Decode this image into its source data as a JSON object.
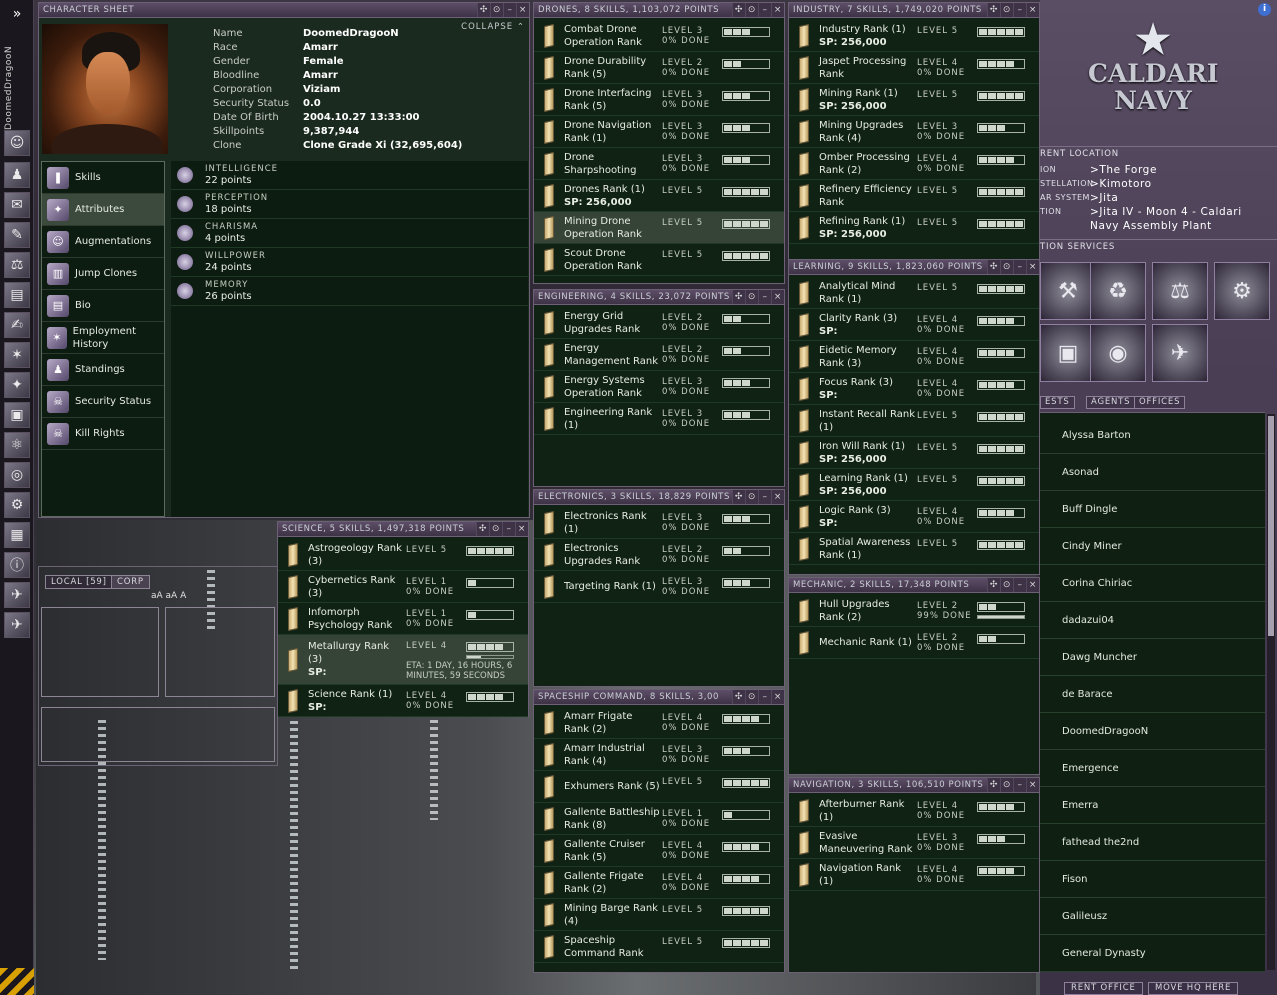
{
  "sidebar": {
    "expand": "»",
    "pilot": "DoomedDragooN"
  },
  "char": {
    "title": "CHARACTER SHEET",
    "collapse": "COLLAPSE",
    "fields": [
      {
        "k": "Name",
        "v": "DoomedDragooN"
      },
      {
        "k": "Race",
        "v": "Amarr"
      },
      {
        "k": "Gender",
        "v": "Female"
      },
      {
        "k": "Bloodline",
        "v": "Amarr"
      },
      {
        "k": "Corporation",
        "v": "Viziam"
      },
      {
        "k": "Security Status",
        "v": "0.0"
      },
      {
        "k": "Date Of Birth",
        "v": "2004.10.27 13:33:00"
      },
      {
        "k": "Skillpoints",
        "v": "9,387,944"
      },
      {
        "k": "Clone",
        "v": "Clone Grade Xi (32,695,604)"
      }
    ],
    "nav": [
      "Skills",
      "Attributes",
      "Augmentations",
      "Jump Clones",
      "Bio",
      "Employment History",
      "Standings",
      "Security Status",
      "Kill Rights"
    ],
    "attrs": [
      {
        "n": "INTELLIGENCE",
        "v": "22 points"
      },
      {
        "n": "PERCEPTION",
        "v": "18 points"
      },
      {
        "n": "CHARISMA",
        "v": "4 points"
      },
      {
        "n": "WILLPOWER",
        "v": "24 points"
      },
      {
        "n": "MEMORY",
        "v": "26 points"
      }
    ]
  },
  "panels": {
    "drones": {
      "title": "DRONES, 8 SKILLS, 1,103,072 POINTS",
      "skills": [
        {
          "n": "Combat Drone Operation Rank",
          "lvl": "LEVEL 3",
          "done": "0% DONE",
          "bars": 3
        },
        {
          "n": "Drone Durability Rank (5)",
          "lvl": "LEVEL 2",
          "done": "0% DONE",
          "bars": 2
        },
        {
          "n": "Drone Interfacing Rank (5)",
          "lvl": "LEVEL 3",
          "done": "0% DONE",
          "bars": 3
        },
        {
          "n": "Drone Navigation Rank (1)",
          "lvl": "LEVEL 3",
          "done": "0% DONE",
          "bars": 3
        },
        {
          "n": "Drone Sharpshooting",
          "lvl": "LEVEL 3",
          "done": "0% DONE",
          "bars": 3
        },
        {
          "n": "Drones Rank (1)",
          "sp": "SP: 256,000",
          "lvl": "LEVEL 5",
          "bars": 5
        },
        {
          "n": "Mining Drone Operation Rank",
          "lvl": "LEVEL 5",
          "bars": 5,
          "hl": true
        },
        {
          "n": "Scout Drone Operation Rank",
          "lvl": "LEVEL 5",
          "bars": 5
        }
      ]
    },
    "industry": {
      "title": "INDUSTRY, 7 SKILLS, 1,749,020 POINTS",
      "skills": [
        {
          "n": "Industry Rank (1)",
          "sp": "SP: 256,000",
          "lvl": "LEVEL 5",
          "bars": 5
        },
        {
          "n": "Jaspet Processing Rank",
          "lvl": "LEVEL 4",
          "done": "0% DONE",
          "bars": 4
        },
        {
          "n": "Mining Rank (1)",
          "sp": "SP: 256,000",
          "lvl": "LEVEL 5",
          "bars": 5
        },
        {
          "n": "Mining Upgrades Rank (4)",
          "lvl": "LEVEL 3",
          "done": "0% DONE",
          "bars": 3
        },
        {
          "n": "Omber Processing Rank (2)",
          "lvl": "LEVEL 4",
          "done": "0% DONE",
          "bars": 4
        },
        {
          "n": "Refinery Efficiency Rank",
          "lvl": "LEVEL 5",
          "bars": 5
        },
        {
          "n": "Refining Rank (1)",
          "sp": "SP: 256,000",
          "lvl": "LEVEL 5",
          "bars": 5
        }
      ]
    },
    "engineering": {
      "title": "ENGINEERING, 4 SKILLS, 23,072 POINTS",
      "skills": [
        {
          "n": "Energy Grid Upgrades Rank",
          "lvl": "LEVEL 2",
          "done": "0% DONE",
          "bars": 2
        },
        {
          "n": "Energy Management Rank",
          "lvl": "LEVEL 2",
          "done": "0% DONE",
          "bars": 2
        },
        {
          "n": "Energy Systems Operation Rank",
          "lvl": "LEVEL 3",
          "done": "0% DONE",
          "bars": 3
        },
        {
          "n": "Engineering Rank (1)",
          "lvl": "LEVEL 3",
          "done": "0% DONE",
          "bars": 3
        }
      ]
    },
    "learning": {
      "title": "LEARNING, 9 SKILLS, 1,823,060 POINTS",
      "skills": [
        {
          "n": "Analytical Mind Rank (1)",
          "lvl": "LEVEL 5",
          "bars": 5
        },
        {
          "n": "Clarity Rank (3)",
          "sp": "SP:",
          "lvl": "LEVEL 4",
          "done": "0% DONE",
          "bars": 4
        },
        {
          "n": "Eidetic Memory Rank (3)",
          "lvl": "LEVEL 4",
          "done": "0% DONE",
          "bars": 4
        },
        {
          "n": "Focus Rank (3)",
          "sp": "SP:",
          "lvl": "LEVEL 4",
          "done": "0% DONE",
          "bars": 4
        },
        {
          "n": "Instant Recall Rank (1)",
          "lvl": "LEVEL 5",
          "bars": 5
        },
        {
          "n": "Iron Will Rank (1)",
          "sp": "SP: 256,000",
          "lvl": "LEVEL 5",
          "bars": 5
        },
        {
          "n": "Learning Rank (1)",
          "sp": "SP: 256,000",
          "lvl": "LEVEL 5",
          "bars": 5
        },
        {
          "n": "Logic Rank (3)",
          "sp": "SP:",
          "lvl": "LEVEL 4",
          "done": "0% DONE",
          "bars": 4
        },
        {
          "n": "Spatial Awareness Rank (1)",
          "lvl": "LEVEL 5",
          "bars": 5
        }
      ]
    },
    "electronics": {
      "title": "ELECTRONICS, 3 SKILLS, 18,829 POINTS",
      "skills": [
        {
          "n": "Electronics Rank (1)",
          "lvl": "LEVEL 3",
          "done": "0% DONE",
          "bars": 3
        },
        {
          "n": "Electronics Upgrades Rank",
          "lvl": "LEVEL 2",
          "done": "0% DONE",
          "bars": 2
        },
        {
          "n": "Targeting Rank (1)",
          "lvl": "LEVEL 3",
          "done": "0% DONE",
          "bars": 3
        }
      ]
    },
    "science": {
      "title": "SCIENCE, 5 SKILLS, 1,497,318 POINTS",
      "skills": [
        {
          "n": "Astrogeology Rank (3)",
          "lvl": "LEVEL 5",
          "bars": 5
        },
        {
          "n": "Cybernetics Rank (3)",
          "lvl": "LEVEL 1",
          "done": "0% DONE",
          "bars": 1
        },
        {
          "n": "Infomorph Psychology Rank",
          "lvl": "LEVEL 1",
          "done": "0% DONE",
          "bars": 1
        },
        {
          "n": "Metallurgy Rank (3)",
          "sp": "SP:",
          "lvl": "LEVEL 4",
          "eta": "ETA: 1 DAY, 16 HOURS, 6 MINUTES, 59 SECONDS",
          "bars": 4,
          "progress": 0.3,
          "hl": true,
          "tall": true
        },
        {
          "n": "Science Rank (1)",
          "sp": "SP:",
          "lvl": "LEVEL 4",
          "done": "0% DONE",
          "bars": 4
        }
      ]
    },
    "mechanic": {
      "title": "MECHANIC, 2 SKILLS, 17,348 POINTS",
      "skills": [
        {
          "n": "Hull Upgrades Rank (2)",
          "lvl": "LEVEL 2",
          "done": "99% DONE",
          "bars": 2,
          "progress": 0.99
        },
        {
          "n": "Mechanic Rank (1)",
          "lvl": "LEVEL 2",
          "done": "0% DONE",
          "bars": 2
        }
      ]
    },
    "spaceship": {
      "title": "SPACESHIP COMMAND, 8 SKILLS, 3,00",
      "skills": [
        {
          "n": "Amarr Frigate Rank (2)",
          "lvl": "LEVEL 4",
          "done": "0% DONE",
          "bars": 4
        },
        {
          "n": "Amarr Industrial Rank (4)",
          "lvl": "LEVEL 3",
          "done": "0% DONE",
          "bars": 3
        },
        {
          "n": "Exhumers Rank (5)",
          "lvl": "LEVEL 5",
          "bars": 5
        },
        {
          "n": "Gallente Battleship Rank (8)",
          "lvl": "LEVEL 1",
          "done": "0% DONE",
          "bars": 1
        },
        {
          "n": "Gallente Cruiser Rank (5)",
          "lvl": "LEVEL 4",
          "done": "0% DONE",
          "bars": 4
        },
        {
          "n": "Gallente Frigate Rank (2)",
          "lvl": "LEVEL 4",
          "done": "0% DONE",
          "bars": 4
        },
        {
          "n": "Mining Barge Rank (4)",
          "lvl": "LEVEL 5",
          "bars": 5
        },
        {
          "n": "Spaceship Command Rank",
          "lvl": "LEVEL 5",
          "bars": 5
        }
      ]
    },
    "navigation": {
      "title": "NAVIGATION, 3 SKILLS, 106,510 POINTS",
      "skills": [
        {
          "n": "Afterburner Rank (1)",
          "lvl": "LEVEL 4",
          "done": "0% DONE",
          "bars": 4
        },
        {
          "n": "Evasive Maneuvering Rank",
          "lvl": "LEVEL 3",
          "done": "0% DONE",
          "bars": 3
        },
        {
          "n": "Navigation Rank (1)",
          "lvl": "LEVEL 4",
          "done": "0% DONE",
          "bars": 4
        }
      ]
    }
  },
  "station": {
    "logo": [
      "CALDARI",
      "NAVY"
    ],
    "current_location": "RENT LOCATION",
    "loc": [
      {
        "k": "ION",
        "v": ">The Forge"
      },
      {
        "k": "STELLATION",
        "v": ">Kimotoro"
      },
      {
        "k": "AR SYSTEM",
        "v": ">Jita"
      },
      {
        "k": "TION",
        "v": ">Jita IV - Moon 4 - Caldari"
      },
      {
        "k": "",
        "v": "Navy Assembly Plant"
      }
    ],
    "services_label": "TION SERVICES",
    "tabs": [
      "ESTS",
      "AGENTS",
      "OFFICES"
    ],
    "guests": [
      "Alyssa Barton",
      "Asonad",
      "Buff Dingle",
      "Cindy Miner",
      "Corina Chiriac",
      "dadazui04",
      "Dawg Muncher",
      "de Barace",
      "DoomedDragooN",
      "Emergence",
      "Emerra",
      "fathead the2nd",
      "Fison",
      "Galileusz",
      "General Dynasty"
    ],
    "buttons": [
      "RENT OFFICE",
      "MOVE HQ HERE"
    ]
  },
  "local": {
    "tabs": [
      "LOCAL [59]",
      "CORP"
    ],
    "fontctl": "aA aA A"
  }
}
